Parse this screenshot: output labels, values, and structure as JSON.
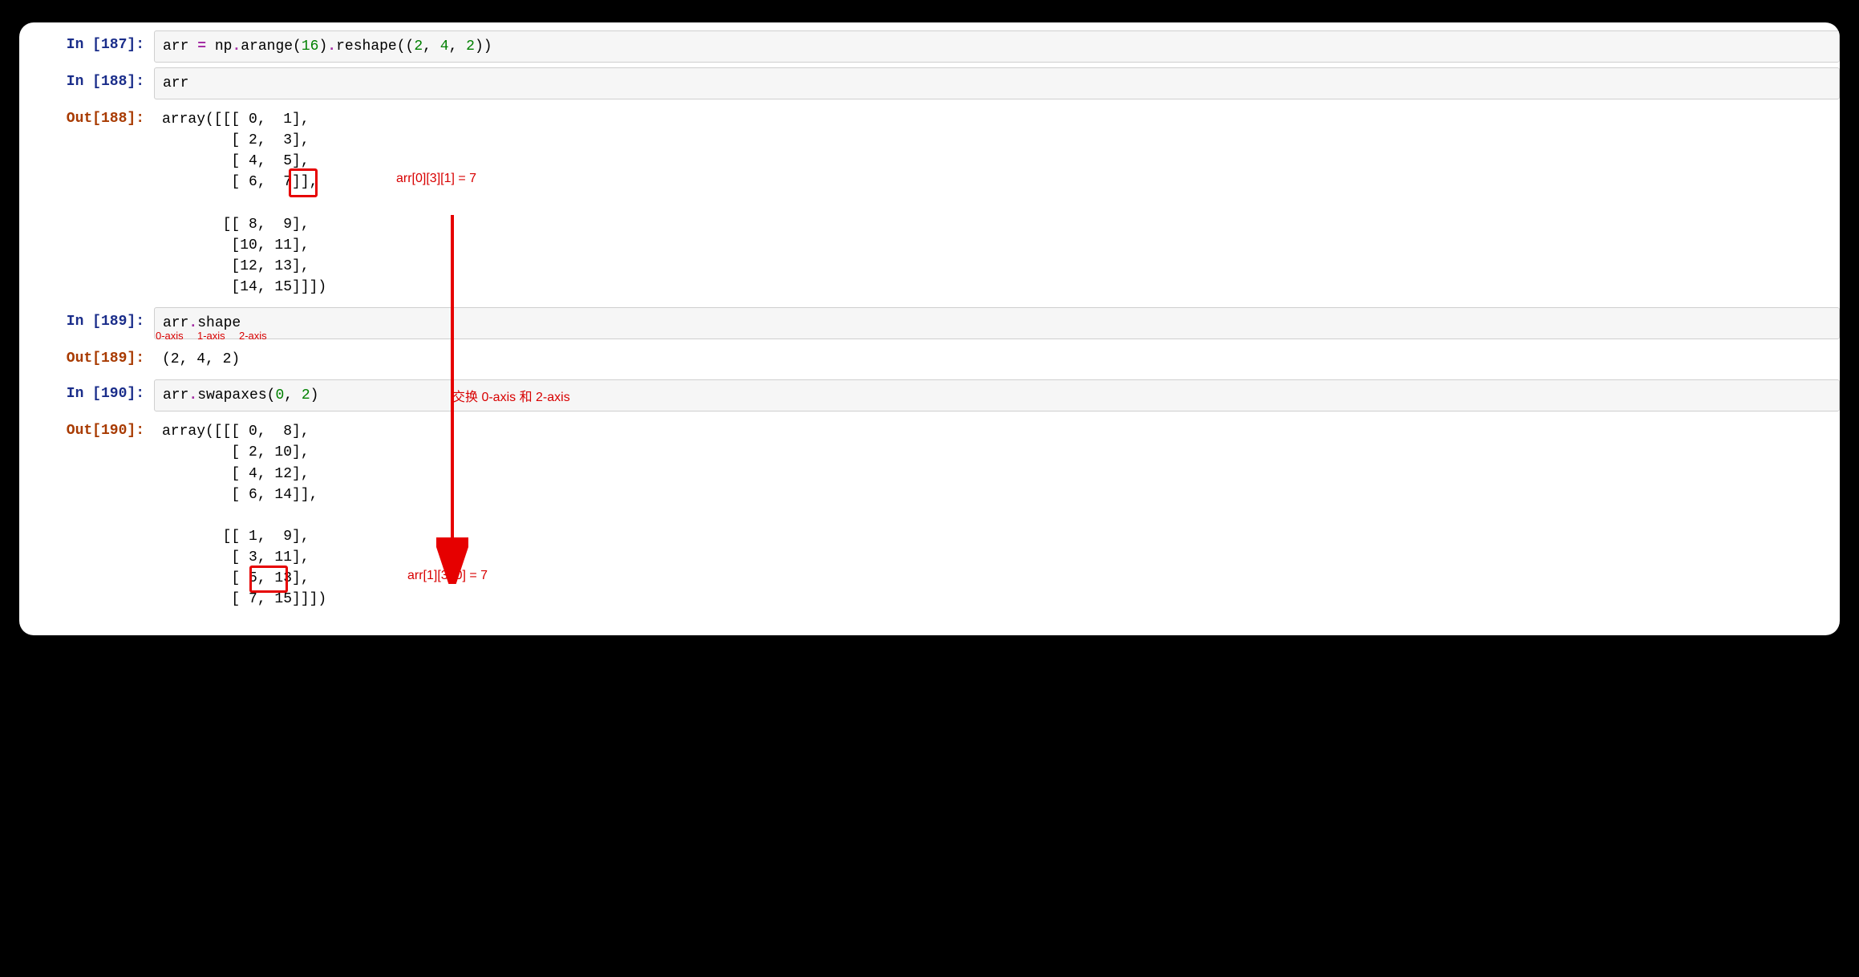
{
  "cells": [
    {
      "prompt_in": "In [187]:",
      "code_tokens": [
        {
          "t": "arr ",
          "c": "txt"
        },
        {
          "t": "=",
          "c": "op"
        },
        {
          "t": " np",
          "c": "txt"
        },
        {
          "t": ".",
          "c": "op"
        },
        {
          "t": "arange(",
          "c": "txt"
        },
        {
          "t": "16",
          "c": "num"
        },
        {
          "t": ")",
          "c": "txt"
        },
        {
          "t": ".",
          "c": "op"
        },
        {
          "t": "reshape((",
          "c": "txt"
        },
        {
          "t": "2",
          "c": "num"
        },
        {
          "t": ", ",
          "c": "txt"
        },
        {
          "t": "4",
          "c": "num"
        },
        {
          "t": ", ",
          "c": "txt"
        },
        {
          "t": "2",
          "c": "num"
        },
        {
          "t": "))",
          "c": "txt"
        }
      ]
    },
    {
      "prompt_in": "In [188]:",
      "code_tokens": [
        {
          "t": "arr",
          "c": "txt"
        }
      ]
    },
    {
      "prompt_out": "Out[188]:",
      "output": "array([[[ 0,  1],\n        [ 2,  3],\n        [ 4,  5],\n        [ 6,  7]],\n\n       [[ 8,  9],\n        [10, 11],\n        [12, 13],\n        [14, 15]]])"
    },
    {
      "prompt_in": "In [189]:",
      "code_tokens": [
        {
          "t": "arr",
          "c": "txt"
        },
        {
          "t": ".",
          "c": "op"
        },
        {
          "t": "shape",
          "c": "txt"
        }
      ]
    },
    {
      "prompt_out": "Out[189]:",
      "output": "(2, 4, 2)"
    },
    {
      "prompt_in": "In [190]:",
      "code_tokens": [
        {
          "t": "arr",
          "c": "txt"
        },
        {
          "t": ".",
          "c": "op"
        },
        {
          "t": "swapaxes(",
          "c": "txt"
        },
        {
          "t": "0",
          "c": "num"
        },
        {
          "t": ", ",
          "c": "txt"
        },
        {
          "t": "2",
          "c": "num"
        },
        {
          "t": ")",
          "c": "txt"
        }
      ]
    },
    {
      "prompt_out": "Out[190]:",
      "output": "array([[[ 0,  8],\n        [ 2, 10],\n        [ 4, 12],\n        [ 6, 14]],\n\n       [[ 1,  9],\n        [ 3, 11],\n        [ 5, 13],\n        [ 7, 15]]])"
    }
  ],
  "annotations": {
    "arr_before": "arr[0][3][1] = 7",
    "arr_after": "arr[1][3][0] = 7",
    "swap_note": "交换 0-axis 和 2-axis",
    "axis0": "0-axis",
    "axis1": "1-axis",
    "axis2": "2-axis"
  }
}
